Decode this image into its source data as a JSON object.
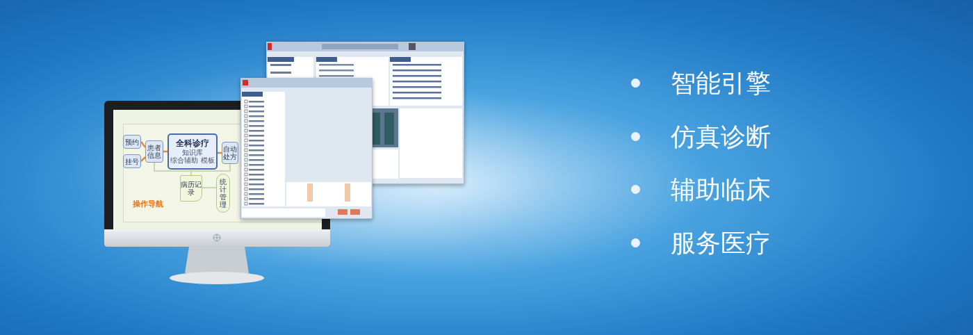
{
  "monitor": {
    "flowchart": {
      "title": "操作导航",
      "nodes": [
        {
          "kind": "box",
          "text": "预约"
        },
        {
          "kind": "box",
          "text": "挂号"
        },
        {
          "kind": "box",
          "text": "患者信息"
        },
        {
          "kind": "main",
          "text": "全科诊疗",
          "lines": [
            "知识库",
            "综合辅助 模板"
          ]
        },
        {
          "kind": "box",
          "text": "自动处方"
        },
        {
          "kind": "doc",
          "text": "病历记录"
        },
        {
          "kind": "pill",
          "text": "统计管理"
        }
      ]
    }
  },
  "features": [
    {
      "label": "智能引擎"
    },
    {
      "label": "仿真诊断"
    },
    {
      "label": "辅助临床"
    },
    {
      "label": "服务医疗"
    }
  ]
}
